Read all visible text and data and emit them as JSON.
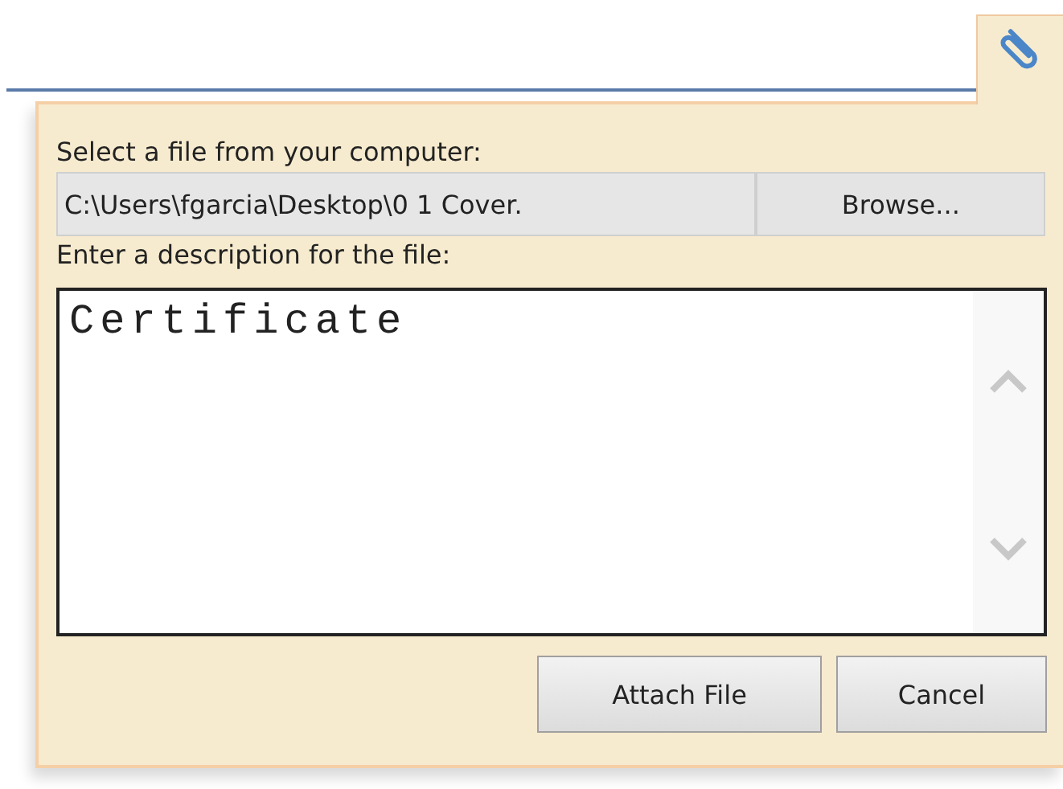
{
  "attach_panel": {
    "file_label": "Select a file from your computer:",
    "file_path": "C:\\Users\\fgarcia\\Desktop\\0 1 Cover.",
    "browse_button": "Browse...",
    "description_label": "Enter a description for the file:",
    "description": "Certificate",
    "buttons": [
      "Attach File",
      "Cancel"
    ]
  }
}
